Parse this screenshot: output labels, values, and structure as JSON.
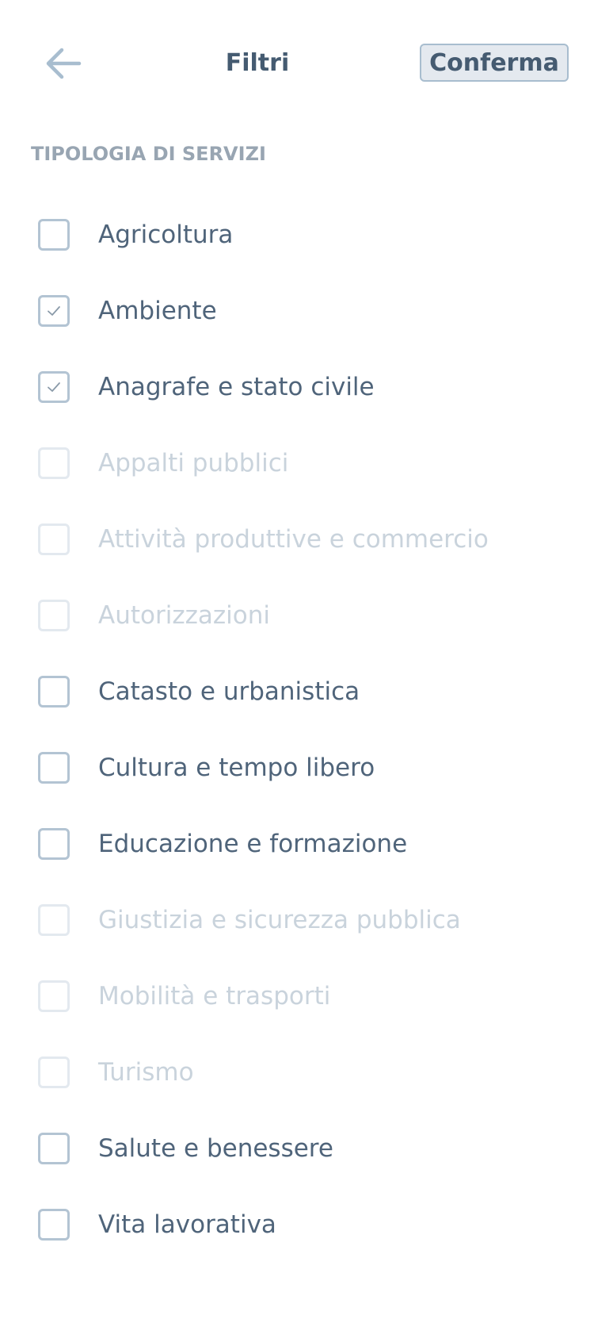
{
  "header": {
    "title": "Filtri",
    "confirm_label": "Conferma",
    "back_icon": "arrow-left-icon"
  },
  "section": {
    "label": "TIPOLOGIA DI SERVIZI"
  },
  "items": [
    {
      "label": "Agricoltura",
      "checked": false,
      "disabled": false
    },
    {
      "label": "Ambiente",
      "checked": true,
      "disabled": false
    },
    {
      "label": "Anagrafe e stato civile",
      "checked": true,
      "disabled": false
    },
    {
      "label": "Appalti pubblici",
      "checked": false,
      "disabled": true
    },
    {
      "label": "Attività produttive e commercio",
      "checked": false,
      "disabled": true
    },
    {
      "label": "Autorizzazioni",
      "checked": false,
      "disabled": true
    },
    {
      "label": "Catasto e urbanistica",
      "checked": false,
      "disabled": false
    },
    {
      "label": "Cultura e tempo libero",
      "checked": false,
      "disabled": false
    },
    {
      "label": "Educazione e formazione",
      "checked": false,
      "disabled": false
    },
    {
      "label": "Giustizia e sicurezza pubblica",
      "checked": false,
      "disabled": true
    },
    {
      "label": "Mobilità e trasporti",
      "checked": false,
      "disabled": true
    },
    {
      "label": "Turismo",
      "checked": false,
      "disabled": true
    },
    {
      "label": "Salute e benessere",
      "checked": false,
      "disabled": false
    },
    {
      "label": "Vita lavorativa",
      "checked": false,
      "disabled": false
    }
  ],
  "colors": {
    "text": "#455b71",
    "muted": "#98a5b2",
    "disabled_text": "#c9d3dc",
    "checkbox_border": "#b3c4d3",
    "button_bg": "#e4e9ef"
  }
}
